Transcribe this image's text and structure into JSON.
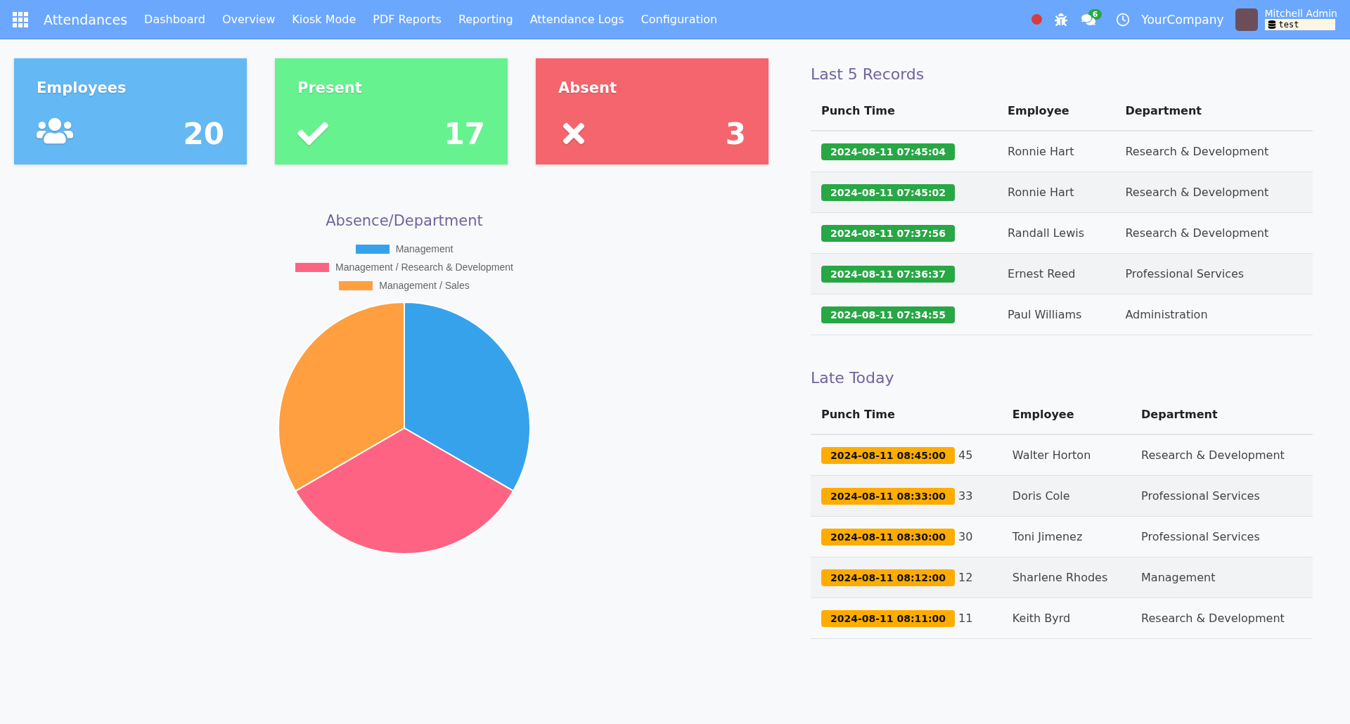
{
  "navbar": {
    "app_title": "Attendances",
    "menu": [
      "Dashboard",
      "Overview",
      "Kiosk Mode",
      "PDF Reports",
      "Reporting",
      "Attendance Logs",
      "Configuration"
    ],
    "message_count": "6",
    "company": "YourCompany",
    "user": "Mitchell Admin",
    "database": "test"
  },
  "cards": [
    {
      "kind": "employees",
      "title": "Employees",
      "value": "20",
      "color": "#64b8f3"
    },
    {
      "kind": "present",
      "title": "Present",
      "value": "17",
      "color": "#66f38f"
    },
    {
      "kind": "absent",
      "title": "Absent",
      "value": "3",
      "color": "#f4656e"
    }
  ],
  "chart_data": {
    "type": "pie",
    "title": "Absence/Department",
    "categories": [
      "Management",
      "Management / Research & Development",
      "Management / Sales"
    ],
    "series": [
      {
        "values": [
          33.33,
          33.33,
          33.34
        ]
      }
    ],
    "colors": [
      "#36a2eb",
      "#ff6384",
      "#ff9f40"
    ]
  },
  "last_records": {
    "title": "Last 5 Records",
    "columns": [
      "Punch Time",
      "Employee",
      "Department"
    ],
    "rows": [
      {
        "time": "2024-08-11 07:45:04",
        "employee": "Ronnie Hart",
        "department": "Research & Development"
      },
      {
        "time": "2024-08-11 07:45:02",
        "employee": "Ronnie Hart",
        "department": "Research & Development"
      },
      {
        "time": "2024-08-11 07:37:56",
        "employee": "Randall Lewis",
        "department": "Research & Development"
      },
      {
        "time": "2024-08-11 07:36:37",
        "employee": "Ernest Reed",
        "department": "Professional Services"
      },
      {
        "time": "2024-08-11 07:34:55",
        "employee": "Paul Williams",
        "department": "Administration"
      }
    ]
  },
  "late_today": {
    "title": "Late Today",
    "columns": [
      "Punch Time",
      "Employee",
      "Department"
    ],
    "rows": [
      {
        "time": "2024-08-11 08:45:00",
        "minutes": "45",
        "employee": "Walter Horton",
        "department": "Research & Development"
      },
      {
        "time": "2024-08-11 08:33:00",
        "minutes": "33",
        "employee": "Doris Cole",
        "department": "Professional Services"
      },
      {
        "time": "2024-08-11 08:30:00",
        "minutes": "30",
        "employee": "Toni Jimenez",
        "department": "Professional Services"
      },
      {
        "time": "2024-08-11 08:12:00",
        "minutes": "12",
        "employee": "Sharlene Rhodes",
        "department": "Management"
      },
      {
        "time": "2024-08-11 08:11:00",
        "minutes": "11",
        "employee": "Keith Byrd",
        "department": "Research & Development"
      }
    ]
  }
}
